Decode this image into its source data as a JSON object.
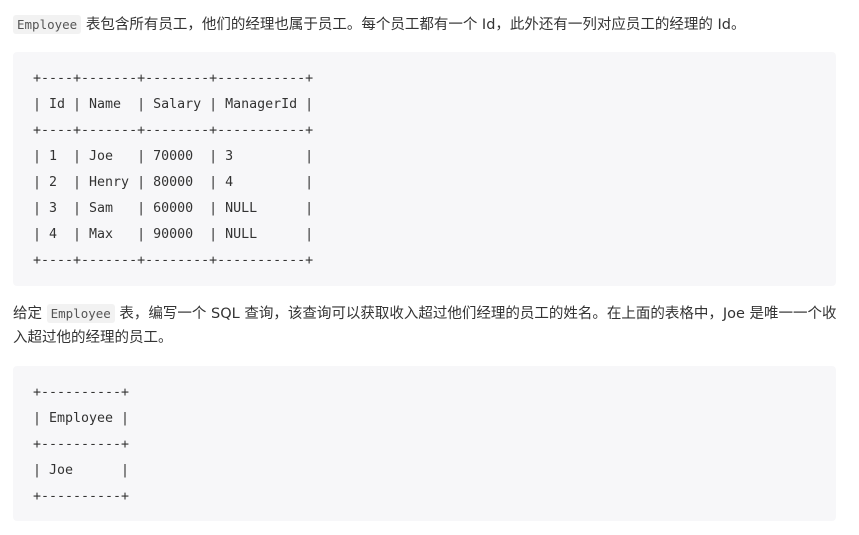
{
  "intro": {
    "code_term": "Employee",
    "text": " 表包含所有员工，他们的经理也属于员工。每个员工都有一个 Id，此外还有一列对应员工的经理的 Id。"
  },
  "employee_table_block": {
    "lines": [
      "+----+-------+--------+-----------+",
      "| Id | Name  | Salary | ManagerId |",
      "+----+-------+--------+-----------+",
      "| 1  | Joe   | 70000  | 3         |",
      "| 2  | Henry | 80000  | 4         |",
      "| 3  | Sam   | 60000  | NULL      |",
      "| 4  | Max   | 90000  | NULL      |",
      "+----+-------+--------+-----------+"
    ]
  },
  "task": {
    "prefix": "给定 ",
    "code_term": "Employee",
    "text": " 表，编写一个 SQL 查询，该查询可以获取收入超过他们经理的员工的姓名。在上面的表格中，Joe 是唯一一个收入超过他的经理的员工。"
  },
  "result_table_block": {
    "lines": [
      "+----------+",
      "| Employee |",
      "+----------+",
      "| Joe      |",
      "+----------+"
    ]
  }
}
